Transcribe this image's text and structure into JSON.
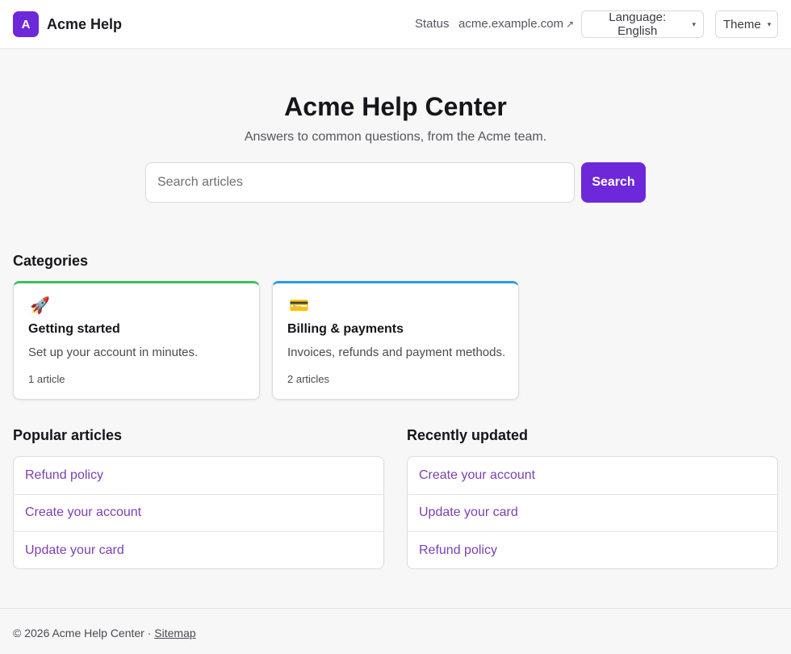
{
  "header": {
    "logo_letter": "A",
    "brand": "Acme Help",
    "nav_status": "Status",
    "nav_site": "acme.example.com",
    "nav_site_ext": "↗",
    "language_label": "Language: English",
    "theme_label": "Theme",
    "caret": "▾"
  },
  "hero": {
    "title": "Acme Help Center",
    "subtitle": "Answers to common questions, from the Acme team.",
    "search_placeholder": "Search articles",
    "search_button": "Search"
  },
  "categories": {
    "heading": "Categories",
    "items": [
      {
        "icon": "🚀",
        "icon_name": "rocket-icon",
        "title": "Getting started",
        "description": "Set up your account in minutes.",
        "count": "1 article",
        "accent": "#3fbf5f"
      },
      {
        "icon": "💳",
        "icon_name": "credit-card-icon",
        "title": "Billing & payments",
        "description": "Invoices, refunds and payment methods.",
        "count": "2 articles",
        "accent": "#2a9ae0"
      }
    ]
  },
  "popular": {
    "heading": "Popular articles",
    "items": [
      "Refund policy",
      "Create your account",
      "Update your card"
    ]
  },
  "recent": {
    "heading": "Recently updated",
    "items": [
      "Create your account",
      "Update your card",
      "Refund policy"
    ]
  },
  "footer": {
    "copyright": "© 2026 Acme Help Center · ",
    "sitemap": "Sitemap"
  },
  "colors": {
    "brand": "#6d28d9",
    "link": "#7b3fb0"
  }
}
